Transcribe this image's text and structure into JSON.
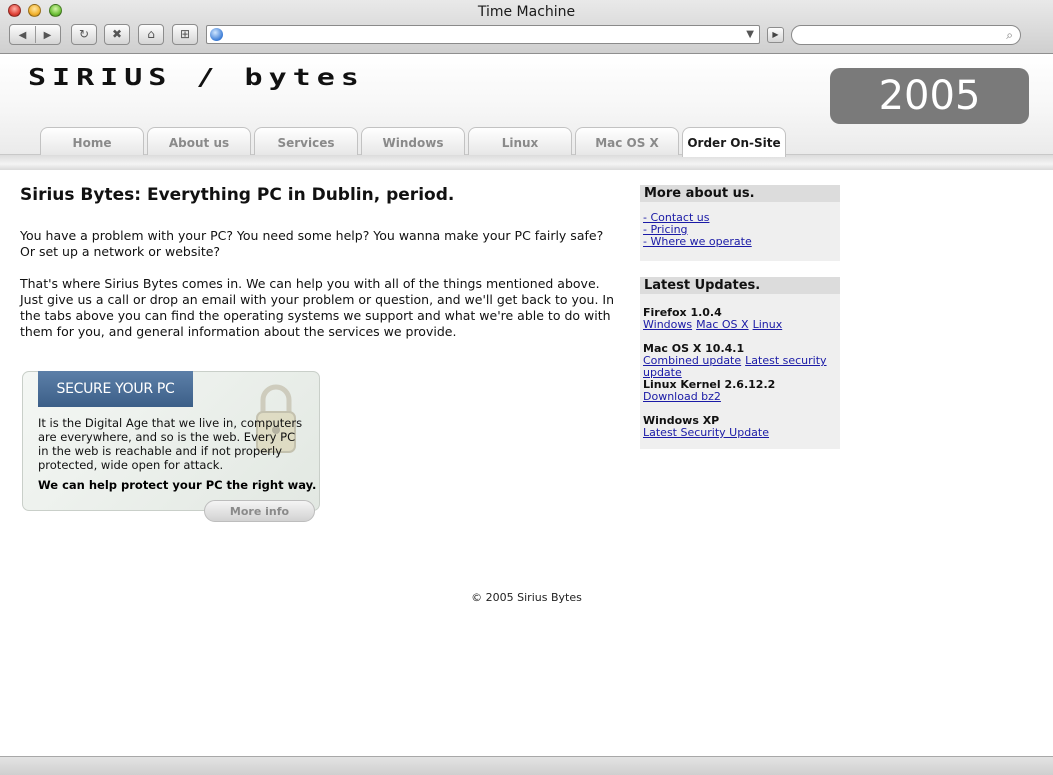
{
  "window": {
    "title": "Time Machine"
  },
  "toolbar": {
    "back_icon": "◀",
    "forward_icon": "▶",
    "reload_icon": "↻",
    "stop_icon": "✖",
    "home_icon": "⌂",
    "add_bookmark_icon": "⊞",
    "url_value": "",
    "url_dropdown_icon": "▼",
    "go_icon": "▶",
    "search_value": "",
    "search_icon": "⌕"
  },
  "site": {
    "logo": "SIRIUS / bytes",
    "year": "2005",
    "tabs": [
      {
        "label": "Home"
      },
      {
        "label": "About us"
      },
      {
        "label": "Services"
      },
      {
        "label": "Windows"
      },
      {
        "label": "Linux"
      },
      {
        "label": "Mac OS X"
      },
      {
        "label": "Order On-Site",
        "active": true
      }
    ]
  },
  "main": {
    "title": "Sirius Bytes: Everything PC in Dublin, period.",
    "paragraph1": "You have a problem with your PC? You need some help? You wanna make your PC fairly safe? Or set up a network or website?",
    "paragraph2": "That's where Sirius Bytes comes in. We can help you with all of the things mentioned above. Just give us a call or drop an email with your problem or question, and we'll get back to you. In the tabs above you can find the operating systems we support and what we're able to do with them for you, and general information about the services we provide."
  },
  "promo": {
    "heading": "SECURE YOUR PC",
    "text": "It is the Digital Age that we live in, computers are everywhere, and so is the web. Every PC in the web is reachable and if not properly protected, wide open for attack.",
    "strong": "We can help protect your PC the right way.",
    "button": "More info"
  },
  "sidebar": {
    "about": {
      "heading": "More about us.",
      "links": [
        "- Contact us",
        "- Pricing",
        "- Where we operate"
      ]
    },
    "updates": {
      "heading": "Latest Updates.",
      "items": [
        {
          "title": "Firefox 1.0.4",
          "links": [
            "Windows",
            "Mac OS X",
            "Linux"
          ]
        },
        {
          "title": "Mac OS X 10.4.1",
          "links": [
            "Combined update",
            "Latest security update"
          ]
        },
        {
          "title": "Linux Kernel 2.6.12.2",
          "links": [
            "Download bz2"
          ]
        },
        {
          "title": "Windows XP",
          "links": [
            "Latest Security Update"
          ]
        }
      ]
    }
  },
  "footer": {
    "text": "© 2005 Sirius Bytes"
  }
}
